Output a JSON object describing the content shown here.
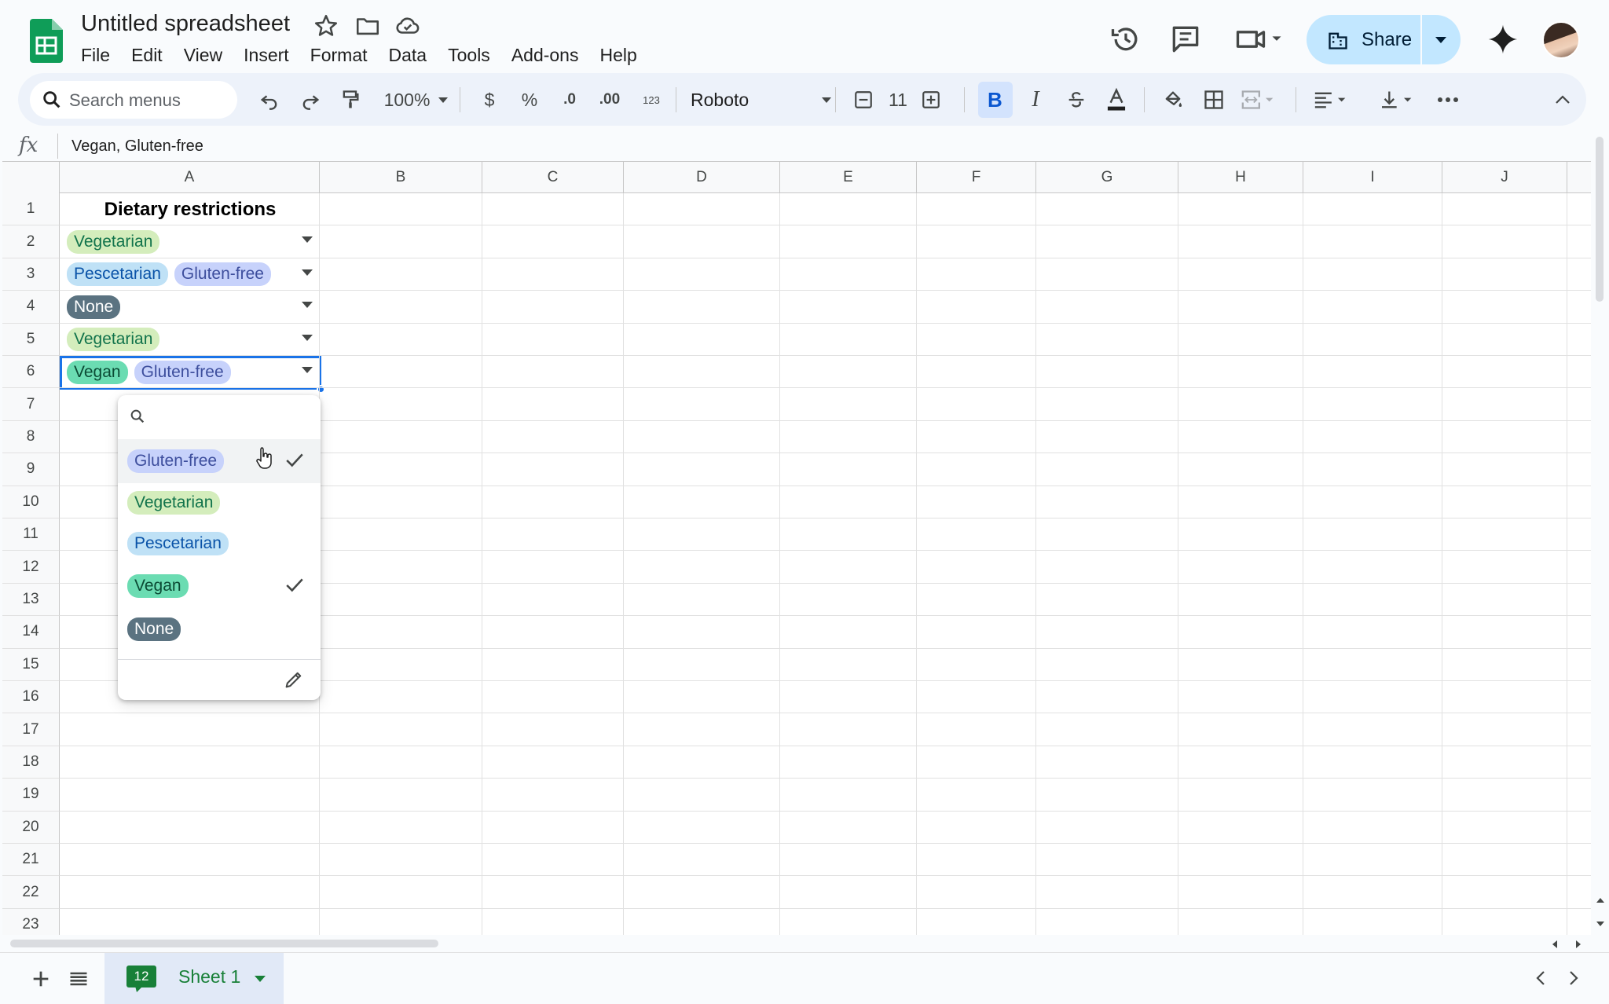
{
  "app": {
    "doc_title": "Untitled spreadsheet",
    "menus": [
      "File",
      "Edit",
      "View",
      "Insert",
      "Format",
      "Data",
      "Tools",
      "Add-ons",
      "Help"
    ],
    "share_label": "Share"
  },
  "toolbar": {
    "search_placeholder": "Search menus",
    "zoom": "100%",
    "currency": "$",
    "percent": "%",
    "decimal_decrease": ".0",
    "decimal_increase": ".00",
    "number_format": "123",
    "font": "Roboto",
    "font_size": "11"
  },
  "formula_bar": {
    "fx": "fx",
    "value": "Vegan, Gluten-free"
  },
  "grid": {
    "columns": [
      "A",
      "B",
      "C",
      "D",
      "E",
      "F",
      "G",
      "H",
      "I",
      "J"
    ],
    "rows": [
      "1",
      "2",
      "3",
      "4",
      "5",
      "6",
      "7",
      "8",
      "9",
      "10",
      "11",
      "12",
      "13",
      "14",
      "15",
      "16",
      "17",
      "18",
      "19",
      "20",
      "21",
      "22",
      "23"
    ],
    "header_cell": "Dietary restrictions",
    "cells": [
      {
        "row": 2,
        "chips": [
          {
            "label": "Vegetarian",
            "kind": "vegetarian"
          }
        ]
      },
      {
        "row": 3,
        "chips": [
          {
            "label": "Pescetarian",
            "kind": "pescetarian"
          },
          {
            "label": "Gluten-free",
            "kind": "glutenfree"
          }
        ]
      },
      {
        "row": 4,
        "chips": [
          {
            "label": "None",
            "kind": "none"
          }
        ]
      },
      {
        "row": 5,
        "chips": [
          {
            "label": "Vegetarian",
            "kind": "vegetarian"
          }
        ]
      },
      {
        "row": 6,
        "chips": [
          {
            "label": "Vegan",
            "kind": "vegan"
          },
          {
            "label": "Gluten-free",
            "kind": "glutenfree"
          }
        ],
        "selected": true
      }
    ]
  },
  "dropdown": {
    "options": [
      {
        "label": "Gluten-free",
        "kind": "glutenfree",
        "checked": true,
        "hover": true
      },
      {
        "label": "Vegetarian",
        "kind": "vegetarian",
        "checked": false
      },
      {
        "label": "Pescetarian",
        "kind": "pescetarian",
        "checked": false
      },
      {
        "label": "Vegan",
        "kind": "vegan",
        "checked": true
      },
      {
        "label": "None",
        "kind": "none",
        "checked": false
      }
    ]
  },
  "sheets": {
    "badge": "12",
    "active_sheet": "Sheet 1"
  },
  "colors": {
    "accent": "#1a73e8",
    "share_bg": "#c2e7ff",
    "sheets_green": "#188038",
    "chip_vegetarian": "#d4edbc",
    "chip_pescetarian": "#bfe1f6",
    "chip_glutenfree": "#c7d2fb",
    "chip_vegan": "#6bdcb2",
    "chip_none": "#5b7381"
  }
}
